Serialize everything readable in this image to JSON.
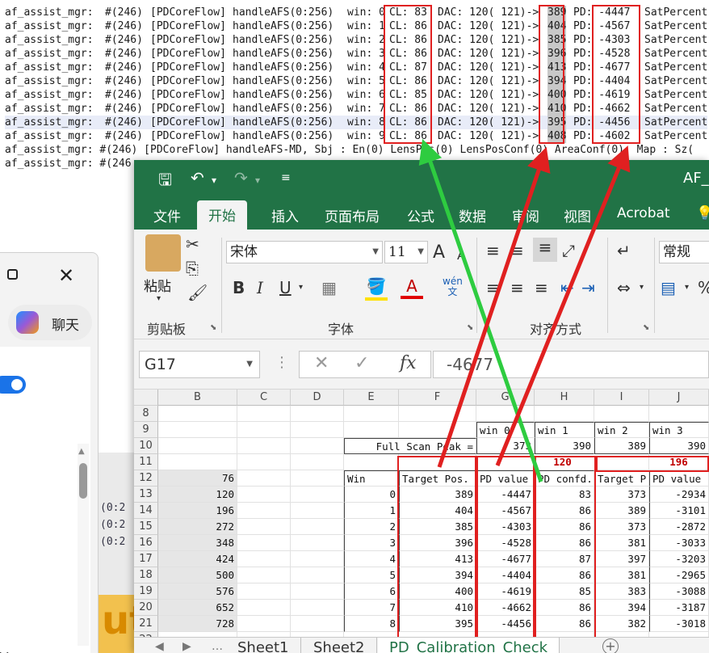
{
  "log": {
    "lines": [
      {
        "prefix": "af_assist_mgr:",
        "tid": "#(246)",
        "tag": "[PDCoreFlow]",
        "fn": "handleAFS(0:256)",
        "win": "win: 0",
        "cl": "CL: 83",
        "dac": "DAC: 120( 121)->",
        "target": "389",
        "pd": "PD: -4447",
        "sat": "SatPercent:"
      },
      {
        "prefix": "af_assist_mgr:",
        "tid": "#(246)",
        "tag": "[PDCoreFlow]",
        "fn": "handleAFS(0:256)",
        "win": "win: 1",
        "cl": "CL: 86",
        "dac": "DAC: 120( 121)->",
        "target": "404",
        "pd": "PD: -4567",
        "sat": "SatPercent:"
      },
      {
        "prefix": "af_assist_mgr:",
        "tid": "#(246)",
        "tag": "[PDCoreFlow]",
        "fn": "handleAFS(0:256)",
        "win": "win: 2",
        "cl": "CL: 86",
        "dac": "DAC: 120( 121)->",
        "target": "385",
        "pd": "PD: -4303",
        "sat": "SatPercent:"
      },
      {
        "prefix": "af_assist_mgr:",
        "tid": "#(246)",
        "tag": "[PDCoreFlow]",
        "fn": "handleAFS(0:256)",
        "win": "win: 3",
        "cl": "CL: 86",
        "dac": "DAC: 120( 121)->",
        "target": "396",
        "pd": "PD: -4528",
        "sat": "SatPercent:"
      },
      {
        "prefix": "af_assist_mgr:",
        "tid": "#(246)",
        "tag": "[PDCoreFlow]",
        "fn": "handleAFS(0:256)",
        "win": "win: 4",
        "cl": "CL: 87",
        "dac": "DAC: 120( 121)->",
        "target": "413",
        "pd": "PD: -4677",
        "sat": "SatPercent:"
      },
      {
        "prefix": "af_assist_mgr:",
        "tid": "#(246)",
        "tag": "[PDCoreFlow]",
        "fn": "handleAFS(0:256)",
        "win": "win: 5",
        "cl": "CL: 86",
        "dac": "DAC: 120( 121)->",
        "target": "394",
        "pd": "PD: -4404",
        "sat": "SatPercent:"
      },
      {
        "prefix": "af_assist_mgr:",
        "tid": "#(246)",
        "tag": "[PDCoreFlow]",
        "fn": "handleAFS(0:256)",
        "win": "win: 6",
        "cl": "CL: 85",
        "dac": "DAC: 120( 121)->",
        "target": "400",
        "pd": "PD: -4619",
        "sat": "SatPercent:"
      },
      {
        "prefix": "af_assist_mgr:",
        "tid": "#(246)",
        "tag": "[PDCoreFlow]",
        "fn": "handleAFS(0:256)",
        "win": "win: 7",
        "cl": "CL: 86",
        "dac": "DAC: 120( 121)->",
        "target": "410",
        "pd": "PD: -4662",
        "sat": "SatPercent:"
      },
      {
        "prefix": "af_assist_mgr:",
        "tid": "#(246)",
        "tag": "[PDCoreFlow]",
        "fn": "handleAFS(0:256)",
        "win": "win: 8",
        "cl": "CL: 86",
        "dac": "DAC: 120( 121)->",
        "target": "395",
        "pd": "PD: -4456",
        "sat": "SatPercent:"
      },
      {
        "prefix": "af_assist_mgr:",
        "tid": "#(246)",
        "tag": "[PDCoreFlow]",
        "fn": "handleAFS(0:256)",
        "win": "win: 9",
        "cl": "CL: 86",
        "dac": "DAC: 120( 121)->",
        "target": "408",
        "pd": "PD: -4602",
        "sat": "SatPercent:"
      }
    ],
    "md_line": "af_assist_mgr: #(246) [PDCoreFlow] handleAFS-MD, Sbj : En(0) LensPos(0) LensPosConf(0) AreaConf(0), Map : Sz(",
    "last_line": "af_assist_mgr: #(246"
  },
  "left_window": {
    "chat_label": "聊天",
    "background_code": "(0:2\n(0:2\n(0:2",
    "bottom_char": "筒",
    "orange_text": "ut"
  },
  "excel": {
    "title": "AF_",
    "tabs": [
      "文件",
      "开始",
      "插入",
      "页面布局",
      "公式",
      "数据",
      "审阅",
      "视图",
      "Acrobat"
    ],
    "active_tab": "开始",
    "clipboard": {
      "paste": "粘贴",
      "group": "剪贴板"
    },
    "font": {
      "name": "宋体",
      "size": "11",
      "group": "字体",
      "bold": "B",
      "italic": "I",
      "underline": "U",
      "font_color_label": "A",
      "phonetic": "wén\n文",
      "grow": "A",
      "shrink": "A"
    },
    "alignment": {
      "group": "对齐方式"
    },
    "number": {
      "format": "常规",
      "percent": "%"
    },
    "formula_bar": {
      "name_box": "G17",
      "value": "-4677"
    },
    "columns": [
      "B",
      "C",
      "D",
      "E",
      "F",
      "G",
      "H",
      "I",
      "J"
    ],
    "rows": [
      "8",
      "9",
      "10",
      "11",
      "12",
      "13",
      "14",
      "15",
      "16",
      "17",
      "18",
      "19",
      "20",
      "21",
      "22"
    ],
    "row9": {
      "G": "win 0",
      "H": "win 1",
      "I": "win 2",
      "J": "win 3"
    },
    "row10": {
      "label": "Full Scan Peak =",
      "G": "373",
      "H": "390",
      "I": "389",
      "J": "390"
    },
    "row11": {
      "G": "120",
      "J": "196"
    },
    "row12": {
      "B": "76",
      "E": "Win",
      "F": "Target Pos.",
      "G": "PD value",
      "H": "PD confd.",
      "I": "Target P",
      "J": "PD value"
    },
    "table": [
      {
        "B": "120",
        "E": "0",
        "F": "389",
        "G": "-4447",
        "H": "83",
        "I": "373",
        "J": "-2934"
      },
      {
        "B": "196",
        "E": "1",
        "F": "404",
        "G": "-4567",
        "H": "86",
        "I": "389",
        "J": "-3101"
      },
      {
        "B": "272",
        "E": "2",
        "F": "385",
        "G": "-4303",
        "H": "86",
        "I": "373",
        "J": "-2872"
      },
      {
        "B": "348",
        "E": "3",
        "F": "396",
        "G": "-4528",
        "H": "86",
        "I": "381",
        "J": "-3033"
      },
      {
        "B": "424",
        "E": "4",
        "F": "413",
        "G": "-4677",
        "H": "87",
        "I": "397",
        "J": "-3203"
      },
      {
        "B": "500",
        "E": "5",
        "F": "394",
        "G": "-4404",
        "H": "86",
        "I": "381",
        "J": "-2965"
      },
      {
        "B": "576",
        "E": "6",
        "F": "400",
        "G": "-4619",
        "H": "85",
        "I": "383",
        "J": "-3088"
      },
      {
        "B": "652",
        "E": "7",
        "F": "410",
        "G": "-4662",
        "H": "86",
        "I": "394",
        "J": "-3187"
      },
      {
        "B": "728",
        "E": "8",
        "F": "395",
        "G": "-4456",
        "H": "86",
        "I": "382",
        "J": "-3018"
      }
    ],
    "sheets": [
      "Sheet1",
      "Sheet2",
      "PD_Calibration_Check"
    ],
    "active_sheet": "PD_Calibration_Check",
    "colors": {
      "excel_green": "#217346",
      "annotation_red": "#e02020",
      "annotation_green": "#2ecc40"
    }
  }
}
